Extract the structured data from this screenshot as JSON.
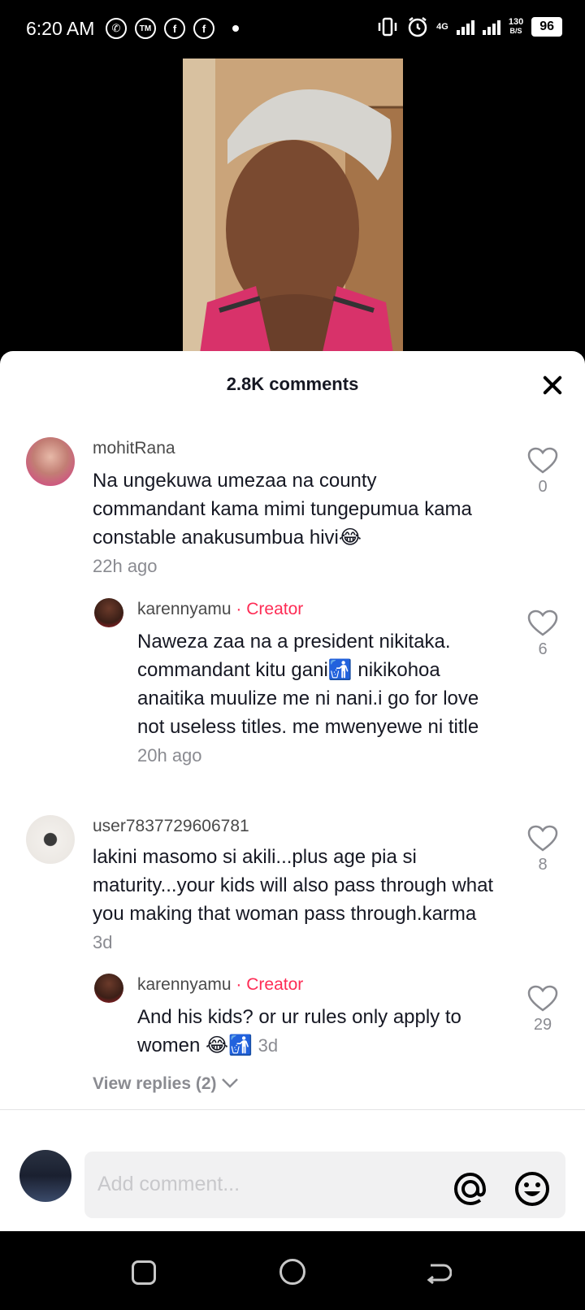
{
  "status_bar": {
    "time": "6:20 AM",
    "network": "4G",
    "speed_top": "130",
    "speed_bottom": "B/S",
    "battery": "96"
  },
  "sheet": {
    "title": "2.8K comments"
  },
  "comments": [
    {
      "username": "mohitRana",
      "text": "Na ungekuwa umezaa na county commandant kama mimi tungepumua kama constable anakusumbua hivi😂",
      "time": "22h ago",
      "likes": "0"
    },
    {
      "username": "karennyamu",
      "creator_label": "· Creator",
      "text": "Naweza zaa na a president nikitaka. commandant kitu gani🚮 nikikohoa anaitika muulize me ni nani.i go for love not useless titles. me mwenyewe ni title",
      "time": "20h ago",
      "likes": "6"
    },
    {
      "username": "user7837729606781",
      "text": "lakini masomo si akili...plus age pia si maturity...your kids will also pass through what you making that woman pass through.karma",
      "time": "3d",
      "likes": "8"
    },
    {
      "username": "karennyamu",
      "creator_label": "· Creator",
      "text": "And his kids? or ur rules only apply to women 😂🚮",
      "time": "3d",
      "likes": "29"
    }
  ],
  "view_replies": "View replies (2)",
  "input": {
    "placeholder": "Add comment..."
  },
  "icons": [
    "whatsapp-icon",
    "tm-icon",
    "facebook-icon",
    "facebook-icon",
    "vibrate-icon",
    "alarm-icon",
    "signal-icon",
    "battery-icon",
    "close-icon",
    "heart-icon",
    "at-icon",
    "emoji-icon",
    "recents-icon",
    "home-icon",
    "back-icon"
  ]
}
